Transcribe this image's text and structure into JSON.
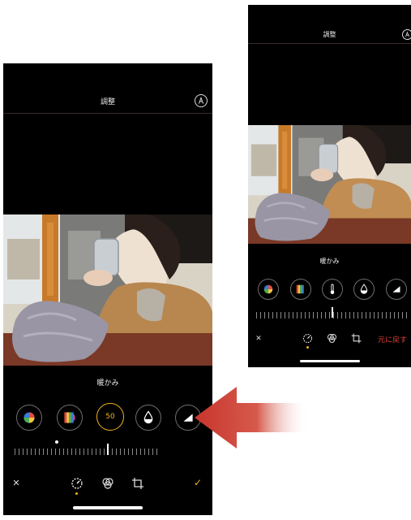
{
  "left_screen": {
    "title": "調整",
    "tool_label": "暖かみ",
    "tool_value": "50",
    "cancel_label": "✕",
    "done_label": "✓",
    "tools": [
      {
        "name": "auto-color-tool",
        "selected": false
      },
      {
        "name": "saturation-tool",
        "selected": false
      },
      {
        "name": "warmth-tool",
        "selected": true
      },
      {
        "name": "tint-tool",
        "selected": false
      },
      {
        "name": "sharpness-tool",
        "selected": false
      }
    ]
  },
  "right_screen": {
    "title": "調整",
    "tool_label": "暖かみ",
    "cancel_label": "✕",
    "revert_label": "元に戻す"
  },
  "colors": {
    "accent": "#f2b01e",
    "revert": "#e0443a",
    "arrow": "#c8342c"
  }
}
